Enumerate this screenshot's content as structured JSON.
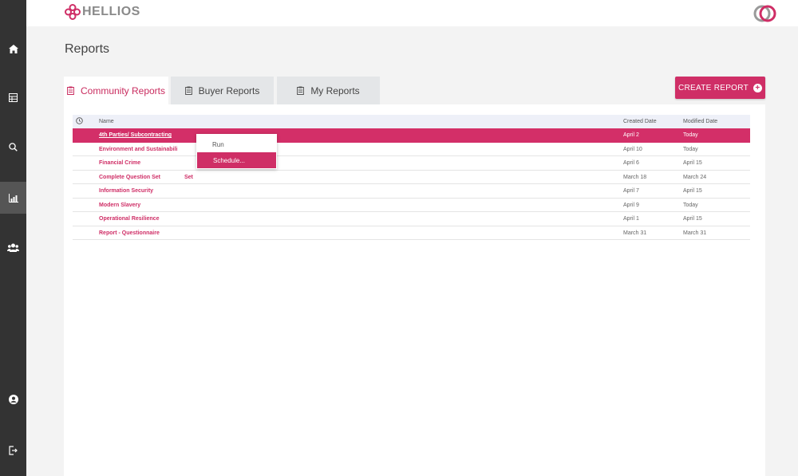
{
  "brand": {
    "name": "HELLIOS",
    "accent": "#cf2e66"
  },
  "sidebar": {
    "items": [
      {
        "icon": "home-icon"
      },
      {
        "icon": "grid-icon"
      },
      {
        "icon": "search-icon"
      },
      {
        "icon": "chart-icon",
        "active": true
      },
      {
        "icon": "users-icon"
      }
    ],
    "bottom": [
      {
        "icon": "user-circle-icon"
      },
      {
        "icon": "logout-icon"
      }
    ]
  },
  "page": {
    "title": "Reports"
  },
  "tabs": [
    {
      "label": "Community Reports",
      "active": true
    },
    {
      "label": "Buyer Reports"
    },
    {
      "label": "My Reports"
    }
  ],
  "create_button": {
    "label": "CREATE REPORT"
  },
  "table": {
    "headers": {
      "name": "Name",
      "created": "Created Date",
      "modified": "Modified Date"
    },
    "rows": [
      {
        "name": "4th Parties/ Subcontracting",
        "created": "April 2",
        "modified": "Today"
      },
      {
        "name": "Environment and Sustainabili",
        "created": "April 10",
        "modified": "Today"
      },
      {
        "name": "Financial Crime",
        "created": "April 6",
        "modified": "April 15"
      },
      {
        "name": "Complete Question Set",
        "extra": "Set",
        "created": "March 18",
        "modified": "March 24"
      },
      {
        "name": "Information Security",
        "created": "April 7",
        "modified": "April 15"
      },
      {
        "name": "Modern Slavery",
        "created": "April 9",
        "modified": "Today"
      },
      {
        "name": "Operational Resilience",
        "created": "April 1",
        "modified": "April 15"
      },
      {
        "name": "Report - Questionnaire",
        "created": "March 31",
        "modified": "March 31"
      }
    ]
  },
  "context_menu": {
    "items": [
      {
        "label": "Run"
      },
      {
        "label": "Schedule..."
      }
    ]
  }
}
